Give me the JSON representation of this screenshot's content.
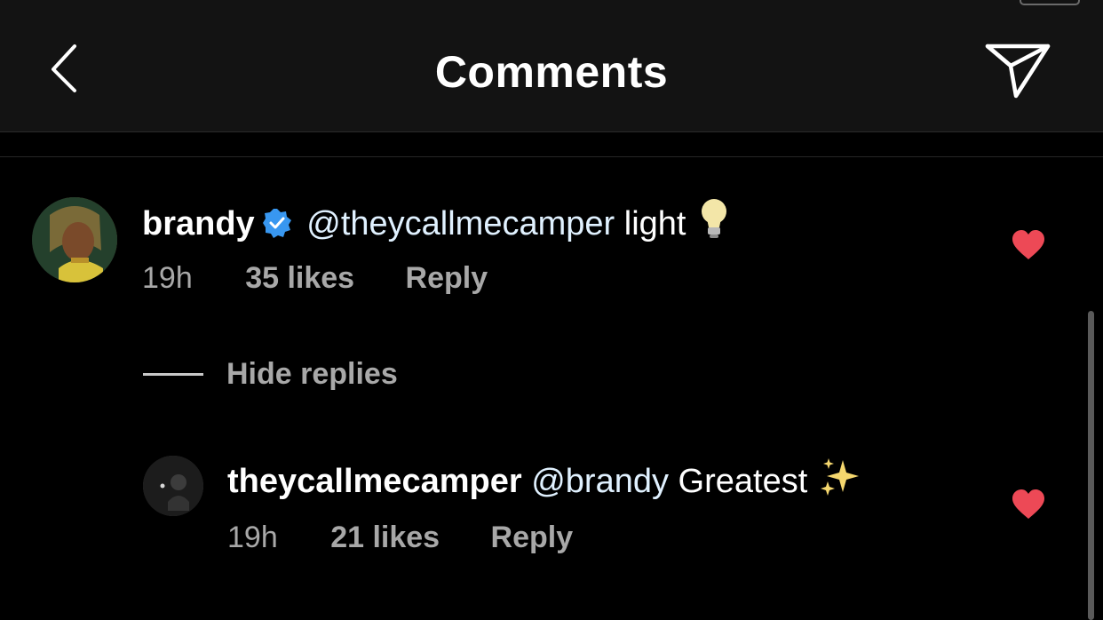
{
  "header": {
    "title": "Comments",
    "back_icon": "chevron-left-icon",
    "send_icon": "paper-plane-icon"
  },
  "comments": [
    {
      "username": "brandy",
      "verified": true,
      "mention": "@theycallmecamper",
      "text": "light",
      "emoji": "lightbulb-icon",
      "time": "19h",
      "likes": "35 likes",
      "reply": "Reply",
      "liked": true
    }
  ],
  "thread": {
    "hide_replies_label": "Hide replies"
  },
  "replies": [
    {
      "username": "theycallmecamper",
      "mention": "@brandy",
      "text": "Greatest",
      "emoji": "sparkles-icon",
      "time": "19h",
      "likes": "21 likes",
      "reply": "Reply",
      "liked": true
    }
  ],
  "colors": {
    "background": "#000000",
    "header_bg": "#131313",
    "heart": "#ed4956",
    "verified": "#3897f0",
    "meta_text": "#a8a8a8",
    "mention_text": "#e0f1ff"
  }
}
